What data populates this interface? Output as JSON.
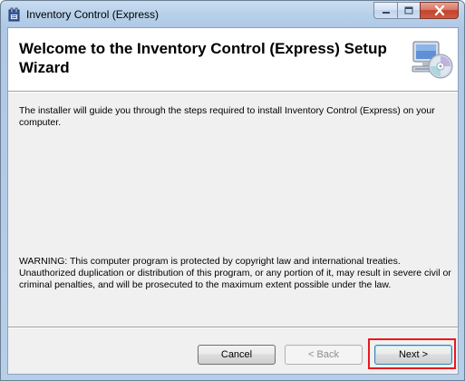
{
  "window": {
    "title": "Inventory Control (Express)",
    "accent_color": "#e8191f"
  },
  "caption_buttons": {
    "minimize_icon": "minimize-icon",
    "maximize_icon": "maximize-icon",
    "close_icon": "close-icon"
  },
  "header": {
    "title": "Welcome to the Inventory Control (Express) Setup Wizard",
    "icon": "computer-cd-icon"
  },
  "body": {
    "intro": "The installer will guide you through the steps required to install Inventory Control (Express) on your computer.",
    "warning": "WARNING: This computer program is protected by copyright law and international treaties. Unauthorized duplication or distribution of this program, or any portion of it, may result in severe civil or criminal penalties, and will be prosecuted to the maximum extent possible under the law."
  },
  "footer": {
    "cancel_label": "Cancel",
    "back_label": "< Back",
    "next_label": "Next >",
    "back_enabled": false
  }
}
